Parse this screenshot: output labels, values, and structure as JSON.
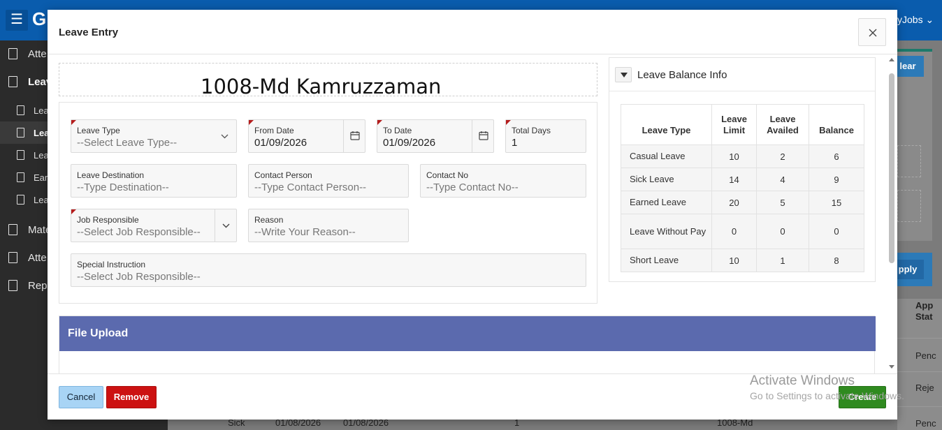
{
  "background": {
    "logo_letter": "G",
    "myjobs_label": "yJobs",
    "sidebar": [
      {
        "label": "Atte",
        "active": false
      },
      {
        "label": "Leav",
        "active": true
      },
      {
        "label": "Mate",
        "active": false
      },
      {
        "label": "Atte",
        "active": false
      },
      {
        "label": "Repo",
        "active": false
      }
    ],
    "sidebar_sub": [
      {
        "label": "Lea",
        "active": false
      },
      {
        "label": "Lea",
        "active": true
      },
      {
        "label": "Lea",
        "active": false
      },
      {
        "label": "Ear",
        "active": false
      },
      {
        "label": "Lea",
        "active": false
      }
    ],
    "clear_label": "lear",
    "apply_label": "pply",
    "table_header": "App Stat",
    "table_cells": [
      "Penc",
      "Reje",
      "Penc"
    ],
    "bottom_row": [
      "Sick",
      "01/08/2026",
      "01/08/2026",
      "1",
      "1008-Md"
    ]
  },
  "modal": {
    "title": "Leave Entry",
    "employee_name": "1008-Md Kamruzzaman",
    "fields": {
      "leave_type": {
        "label": "Leave Type",
        "placeholder": "--Select Leave Type--"
      },
      "from_date": {
        "label": "From Date",
        "value": "01/09/2026"
      },
      "to_date": {
        "label": "To Date",
        "value": "01/09/2026"
      },
      "total_days": {
        "label": "Total Days",
        "value": "1"
      },
      "leave_destination": {
        "label": "Leave Destination",
        "placeholder": "--Type Destination--"
      },
      "contact_person": {
        "label": "Contact Person",
        "placeholder": "--Type Contact Person--"
      },
      "contact_no": {
        "label": "Contact No",
        "placeholder": "--Type Contact No--"
      },
      "job_responsible": {
        "label": "Job Responsible",
        "placeholder": "--Select Job Responsible--"
      },
      "reason": {
        "label": "Reason",
        "placeholder": "--Write Your Reason--"
      },
      "special_instruction": {
        "label": "Special Instruction",
        "placeholder": "--Select Job Responsible--"
      }
    },
    "file_upload_title": "File Upload",
    "balance": {
      "title": "Leave Balance Info",
      "headers": [
        "Leave Type",
        "Leave Limit",
        "Leave Availed",
        "Balance"
      ],
      "rows": [
        {
          "type": "Casual Leave",
          "limit": "10",
          "availed": "2",
          "balance": "6"
        },
        {
          "type": "Sick Leave",
          "limit": "14",
          "availed": "4",
          "balance": "9"
        },
        {
          "type": "Earned Leave",
          "limit": "20",
          "availed": "5",
          "balance": "15"
        },
        {
          "type": "Leave Without Pay",
          "limit": "0",
          "availed": "0",
          "balance": "0"
        },
        {
          "type": "Short Leave",
          "limit": "10",
          "availed": "1",
          "balance": "8"
        }
      ]
    },
    "buttons": {
      "cancel": "Cancel",
      "remove": "Remove",
      "create": "Create"
    }
  },
  "watermark": {
    "line1": "Activate Windows",
    "line2": "Go to Settings to activate Windows."
  },
  "colors": {
    "header_blue": "#0a5cad",
    "file_upload_header": "#5b6aae",
    "create_green": "#2f8a1f",
    "remove_red": "#cc1111",
    "cancel_blue": "#a8d4f5",
    "required_marker": "#b51c1c"
  }
}
